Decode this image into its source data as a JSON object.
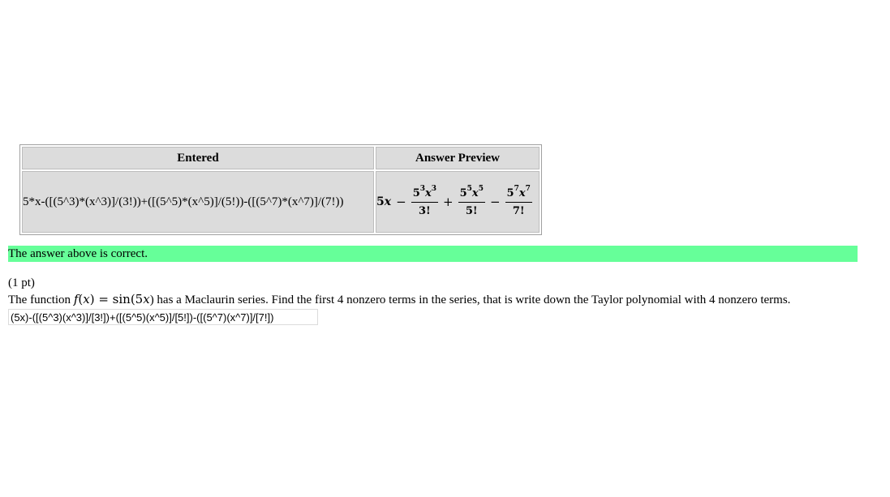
{
  "results_table": {
    "headers": {
      "entered": "Entered",
      "preview": "Answer Preview"
    },
    "entered_value": "5*x-([(5^3)*(x^3)]/(3!))+([(5^5)*(x^5)]/(5!))-([(5^7)*(x^7)]/(7!))",
    "preview": {
      "lead_coef": "5",
      "lead_var": "x",
      "op1": "−",
      "term1": {
        "num_coef": "5",
        "num_coef_exp": "3",
        "num_var": "x",
        "num_var_exp": "3",
        "den": "3!"
      },
      "op2": "+",
      "term2": {
        "num_coef": "5",
        "num_coef_exp": "5",
        "num_var": "x",
        "num_var_exp": "5",
        "den": "5!"
      },
      "op3": "−",
      "term3": {
        "num_coef": "5",
        "num_coef_exp": "7",
        "num_var": "x",
        "num_var_exp": "7",
        "den": "7!"
      }
    }
  },
  "status": {
    "message": "The answer above is correct.",
    "color": "#66ff99"
  },
  "problem": {
    "points": "(1 pt)",
    "text_before": "The function ",
    "func_name": "f",
    "func_arg": "x",
    "equals": " = sin(5",
    "sin_var": "x",
    "text_after": ") has a Maclaurin series. Find the first 4 nonzero terms in the series, that is write down the Taylor polynomial with 4 nonzero terms."
  },
  "answer_field": {
    "value": "(5x)-([(5^3)(x^3)]/[3!])+([(5^5)(x^5)]/[5!])-([(5^7)(x^7)]/[7!])"
  }
}
